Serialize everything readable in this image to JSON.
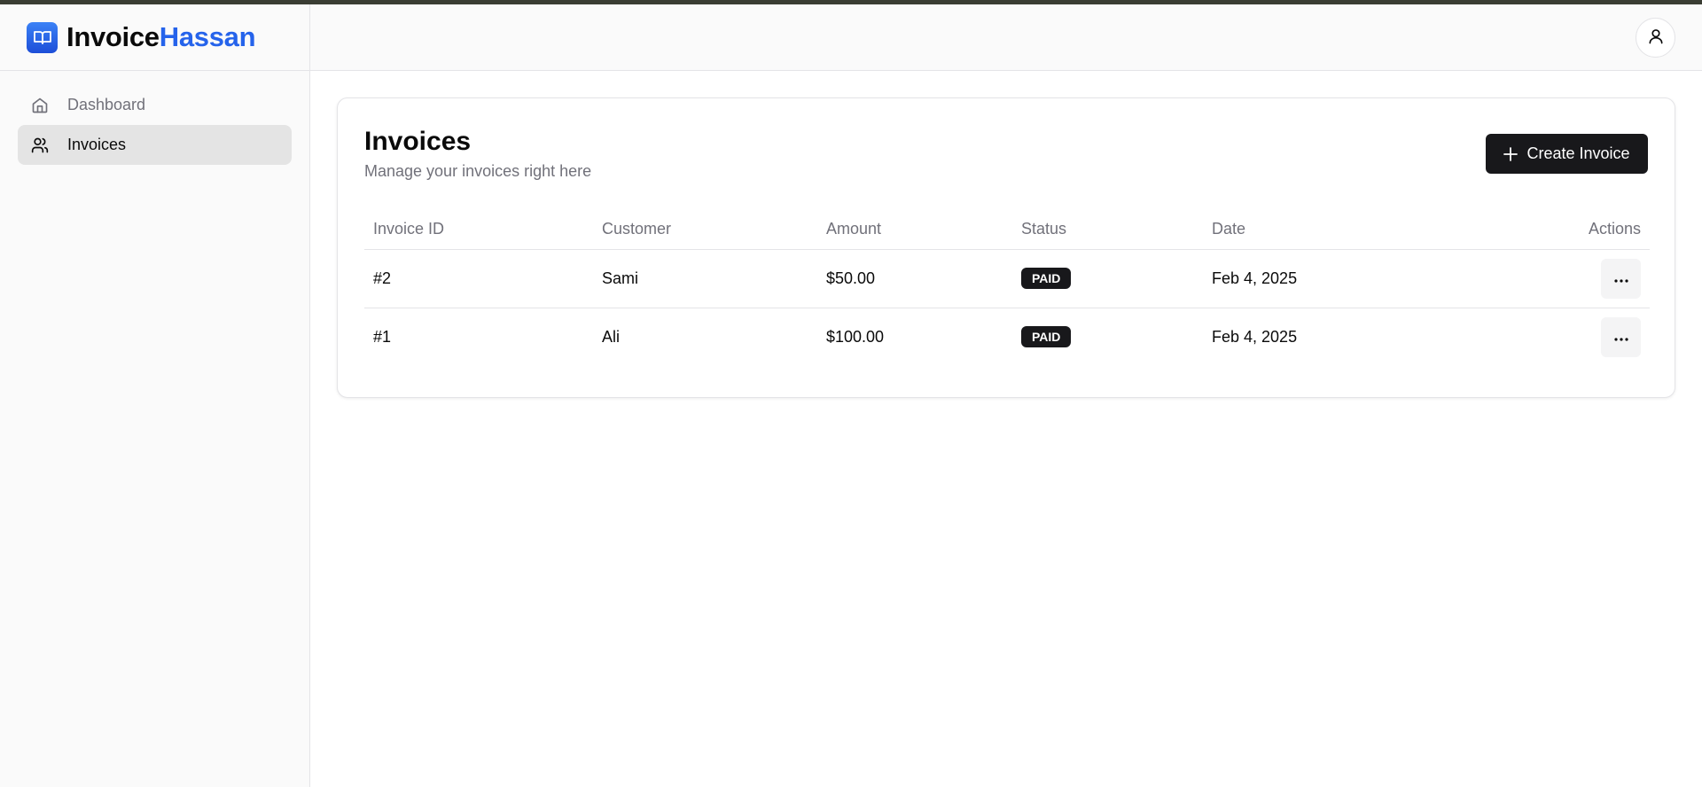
{
  "colors": {
    "accent": "#2563eb",
    "primary_button": "#18181b",
    "badge_bg": "#18181b",
    "sidebar_active": "#e4e4e4"
  },
  "brand": {
    "name_part1": "Invoice",
    "name_part2": "Hassan",
    "logo_icon": "book-open-icon"
  },
  "sidebar": {
    "items": [
      {
        "label": "Dashboard",
        "icon": "home-icon",
        "active": false
      },
      {
        "label": "Invoices",
        "icon": "users-icon",
        "active": true
      }
    ]
  },
  "header": {
    "user_icon": "user-icon"
  },
  "main": {
    "title": "Invoices",
    "subtitle": "Manage your invoices right here",
    "create_button_label": "Create Invoice",
    "table": {
      "columns": [
        "Invoice ID",
        "Customer",
        "Amount",
        "Status",
        "Date",
        "Actions"
      ],
      "rows": [
        {
          "id": "#2",
          "customer": "Sami",
          "amount": "$50.00",
          "status": "PAID",
          "date": "Feb 4, 2025"
        },
        {
          "id": "#1",
          "customer": "Ali",
          "amount": "$100.00",
          "status": "PAID",
          "date": "Feb 4, 2025"
        }
      ]
    }
  }
}
